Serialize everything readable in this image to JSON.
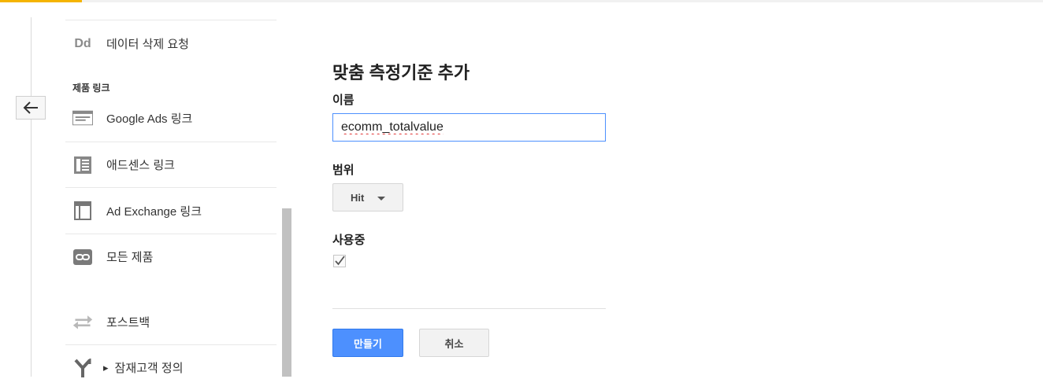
{
  "sidebar": {
    "back_label": "←",
    "items": [
      {
        "icon": "dd-text-icon",
        "icon_text": "Dd",
        "label": "데이터 삭제 요청"
      },
      {
        "icon": "google-ads-icon",
        "label": "Google Ads 링크"
      },
      {
        "icon": "adsense-icon",
        "label": "애드센스 링크"
      },
      {
        "icon": "ad-exchange-icon",
        "label": "Ad Exchange 링크"
      },
      {
        "icon": "link-icon",
        "label": "모든 제품"
      },
      {
        "icon": "postback-arrows-icon",
        "label": "포스트백"
      },
      {
        "icon": "audience-fork-icon",
        "expand_glyph": "▸",
        "label": "잠재고객 정의"
      }
    ],
    "section_title": "제품 링크"
  },
  "form": {
    "title": "맞춤 측정기준 추가",
    "name_label": "이름",
    "name_value": "ecomm_totalvalue",
    "scope_label": "범위",
    "scope_value": "Hit",
    "active_label": "사용중",
    "active_checked": true,
    "create_label": "만들기",
    "cancel_label": "취소"
  },
  "colors": {
    "accent": "#f5b400",
    "primary_button": "#4d90fe",
    "input_focus_border": "#4d90fe"
  }
}
